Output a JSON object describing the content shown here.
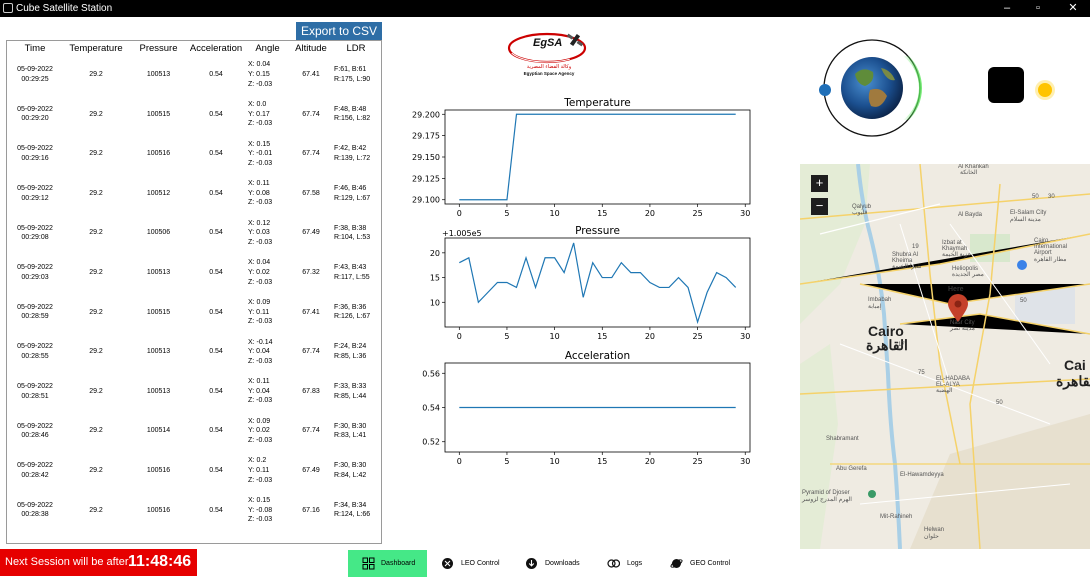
{
  "window": {
    "title": "Cube Satellite Station"
  },
  "toolbar": {
    "export_label": "Export to CSV"
  },
  "table": {
    "headers": [
      "Time",
      "Temperature",
      "Pressure",
      "Acceleration",
      "Angle",
      "Altitude",
      "LDR"
    ],
    "rows": [
      {
        "date": "05-09-2022",
        "clock": "00:29:25",
        "temp": "29.2",
        "pressure": "100513",
        "accel": "0.54",
        "ax": "X: 0.04",
        "ay": "Y: 0.15",
        "az": "Z: -0.03",
        "alt": "67.41",
        "ldr1": "F:61,  B:61",
        "ldr2": "R:175,  L:90"
      },
      {
        "date": "05-09-2022",
        "clock": "00:29:20",
        "temp": "29.2",
        "pressure": "100515",
        "accel": "0.54",
        "ax": "X: 0.0",
        "ay": "Y: 0.17",
        "az": "Z: -0.03",
        "alt": "67.74",
        "ldr1": "F:48,  B:48",
        "ldr2": "R:156,  L:82"
      },
      {
        "date": "05-09-2022",
        "clock": "00:29:16",
        "temp": "29.2",
        "pressure": "100516",
        "accel": "0.54",
        "ax": "X: 0.15",
        "ay": "Y: -0.01",
        "az": "Z: -0.03",
        "alt": "67.74",
        "ldr1": "F:42,  B:42",
        "ldr2": "R:139,  L:72"
      },
      {
        "date": "05-09-2022",
        "clock": "00:29:12",
        "temp": "29.2",
        "pressure": "100512",
        "accel": "0.54",
        "ax": "X: 0.11",
        "ay": "Y: 0.08",
        "az": "Z: -0.03",
        "alt": "67.58",
        "ldr1": "F:46,  B:46",
        "ldr2": "R:129,  L:67"
      },
      {
        "date": "05-09-2022",
        "clock": "00:29:08",
        "temp": "29.2",
        "pressure": "100506",
        "accel": "0.54",
        "ax": "X: 0.12",
        "ay": "Y: 0.03",
        "az": "Z: -0.03",
        "alt": "67.49",
        "ldr1": "F:38,  B:38",
        "ldr2": "R:104,  L:53"
      },
      {
        "date": "05-09-2022",
        "clock": "00:29:03",
        "temp": "29.2",
        "pressure": "100513",
        "accel": "0.54",
        "ax": "X: 0.04",
        "ay": "Y: 0.02",
        "az": "Z: -0.03",
        "alt": "67.32",
        "ldr1": "F:43,  B:43",
        "ldr2": "R:117,  L:55"
      },
      {
        "date": "05-09-2022",
        "clock": "00:28:59",
        "temp": "29.2",
        "pressure": "100515",
        "accel": "0.54",
        "ax": "X: 0.09",
        "ay": "Y: 0.11",
        "az": "Z: -0.03",
        "alt": "67.41",
        "ldr1": "F:36,  B:36",
        "ldr2": "R:126,  L:67"
      },
      {
        "date": "05-09-2022",
        "clock": "00:28:55",
        "temp": "29.2",
        "pressure": "100513",
        "accel": "0.54",
        "ax": "X: -0.14",
        "ay": "Y: 0.04",
        "az": "Z: -0.03",
        "alt": "67.74",
        "ldr1": "F:24,  B:24",
        "ldr2": "R:85,  L:36"
      },
      {
        "date": "05-09-2022",
        "clock": "00:28:51",
        "temp": "29.2",
        "pressure": "100513",
        "accel": "0.54",
        "ax": "X: 0.11",
        "ay": "Y: 0.04",
        "az": "Z: -0.03",
        "alt": "67.83",
        "ldr1": "F:33,  B:33",
        "ldr2": "R:85,  L:44"
      },
      {
        "date": "05-09-2022",
        "clock": "00:28:46",
        "temp": "29.2",
        "pressure": "100514",
        "accel": "0.54",
        "ax": "X: 0.09",
        "ay": "Y: 0.02",
        "az": "Z: -0.03",
        "alt": "67.74",
        "ldr1": "F:30,  B:30",
        "ldr2": "R:83,  L:41"
      },
      {
        "date": "05-09-2022",
        "clock": "00:28:42",
        "temp": "29.2",
        "pressure": "100516",
        "accel": "0.54",
        "ax": "X: 0.2",
        "ay": "Y: 0.11",
        "az": "Z: -0.03",
        "alt": "67.49",
        "ldr1": "F:30,  B:30",
        "ldr2": "R:84,  L:42"
      },
      {
        "date": "05-09-2022",
        "clock": "00:28:38",
        "temp": "29.2",
        "pressure": "100516",
        "accel": "0.54",
        "ax": "X: 0.15",
        "ay": "Y: -0.08",
        "az": "Z: -0.03",
        "alt": "67.16",
        "ldr1": "F:34,  B:34",
        "ldr2": "R:124,  L:66"
      }
    ]
  },
  "logo": {
    "name": "EgSA",
    "arabic": "وكالة الفضاء المصرية",
    "english": "Egyptian Space Agency"
  },
  "chart_data": [
    {
      "type": "line",
      "title": "Temperature",
      "x": [
        0,
        1,
        2,
        3,
        4,
        5,
        6,
        7,
        8,
        9,
        10,
        11,
        12,
        13,
        14,
        15,
        16,
        17,
        18,
        19,
        20,
        21,
        22,
        23,
        24,
        25,
        26,
        27,
        28,
        29
      ],
      "values": [
        29.1,
        29.1,
        29.1,
        29.1,
        29.1,
        29.1,
        29.2,
        29.2,
        29.2,
        29.2,
        29.2,
        29.2,
        29.2,
        29.2,
        29.2,
        29.2,
        29.2,
        29.2,
        29.2,
        29.2,
        29.2,
        29.2,
        29.2,
        29.2,
        29.2,
        29.2,
        29.2,
        29.2,
        29.2,
        29.2
      ],
      "xlim": [
        -1.5,
        30.5
      ],
      "ylim": [
        29.095,
        29.205
      ],
      "xticks": [
        0,
        5,
        10,
        15,
        20,
        25,
        30
      ],
      "yticks": [
        29.1,
        29.125,
        29.15,
        29.175,
        29.2
      ],
      "ytick_labels": [
        "29.100",
        "29.125",
        "29.150",
        "29.175",
        "29.200"
      ],
      "offset_label": "",
      "color": "#1f77b4"
    },
    {
      "type": "line",
      "title": "Pressure",
      "x": [
        0,
        1,
        2,
        3,
        4,
        5,
        6,
        7,
        8,
        9,
        10,
        11,
        12,
        13,
        14,
        15,
        16,
        17,
        18,
        19,
        20,
        21,
        22,
        23,
        24,
        25,
        26,
        27,
        28,
        29
      ],
      "values": [
        18,
        19,
        10,
        12,
        14,
        14,
        13,
        19,
        13,
        19,
        19,
        16,
        22,
        11,
        18,
        15,
        15,
        18,
        16,
        16,
        14,
        13,
        13,
        15,
        13,
        6,
        12,
        16,
        15,
        13
      ],
      "xlim": [
        -1.5,
        30.5
      ],
      "ylim": [
        5,
        23
      ],
      "xticks": [
        0,
        5,
        10,
        15,
        20,
        25,
        30
      ],
      "yticks": [
        10,
        15,
        20
      ],
      "ytick_labels": [
        "10",
        "15",
        "20"
      ],
      "offset_label": "+1.005e5",
      "color": "#1f77b4"
    },
    {
      "type": "line",
      "title": "Acceleration",
      "x": [
        0,
        1,
        2,
        3,
        4,
        5,
        6,
        7,
        8,
        9,
        10,
        11,
        12,
        13,
        14,
        15,
        16,
        17,
        18,
        19,
        20,
        21,
        22,
        23,
        24,
        25,
        26,
        27,
        28,
        29
      ],
      "values": [
        0.54,
        0.54,
        0.54,
        0.54,
        0.54,
        0.54,
        0.54,
        0.54,
        0.54,
        0.54,
        0.54,
        0.54,
        0.54,
        0.54,
        0.54,
        0.54,
        0.54,
        0.54,
        0.54,
        0.54,
        0.54,
        0.54,
        0.54,
        0.54,
        0.54,
        0.54,
        0.54,
        0.54,
        0.54,
        0.54
      ],
      "xlim": [
        -1.5,
        30.5
      ],
      "ylim": [
        0.514,
        0.566
      ],
      "xticks": [
        0,
        5,
        10,
        15,
        20,
        25,
        30
      ],
      "yticks": [
        0.52,
        0.54,
        0.56
      ],
      "ytick_labels": [
        "0.52",
        "0.54",
        "0.56"
      ],
      "offset_label": "",
      "color": "#1f77b4"
    }
  ],
  "map": {
    "labels": [
      {
        "id": "cairo-en",
        "text": "Cairo"
      },
      {
        "id": "cairo-ar",
        "text": "القاهرة"
      },
      {
        "id": "here",
        "text": "Here"
      },
      {
        "id": "nasr-city",
        "text": "Nasr City"
      },
      {
        "id": "nasr-city-ar",
        "text": "مدينة نصر"
      },
      {
        "id": "al-khankah",
        "text": "Al Khankah"
      },
      {
        "id": "al-khankah-ar",
        "text": "الخانكة"
      },
      {
        "id": "qalyub",
        "text": "Qalyub"
      },
      {
        "id": "qalyub-ar",
        "text": "قليوب"
      },
      {
        "id": "al-bayda",
        "text": "Al Bayda"
      },
      {
        "id": "el-salam",
        "text": "El-Salam City"
      },
      {
        "id": "el-salam-ar",
        "text": "مدينة السلام"
      },
      {
        "id": "izbat",
        "text": "Izbat at"
      },
      {
        "id": "khaymah",
        "text": "Khaymah"
      },
      {
        "id": "izbat-ar",
        "text": "عزبة الخيمة"
      },
      {
        "id": "shubra",
        "text": "Shubra Al"
      },
      {
        "id": "kheima",
        "text": "Kheima"
      },
      {
        "id": "shubra-ar",
        "text": "شبرا الخيمة"
      },
      {
        "id": "heliopolis",
        "text": "Heliopolis"
      },
      {
        "id": "heliopolis-ar",
        "text": "مصر الجديدة"
      },
      {
        "id": "airport",
        "text": "Cairo"
      },
      {
        "id": "airport2",
        "text": "International"
      },
      {
        "id": "airport3",
        "text": "Airport"
      },
      {
        "id": "airport-ar",
        "text": "مطار القاهرة"
      },
      {
        "id": "imbabah",
        "text": "Imbabah"
      },
      {
        "id": "imbabah-ar",
        "text": "إمبابة"
      },
      {
        "id": "cairo-right",
        "text": "Cai"
      },
      {
        "id": "cairo-right-ar",
        "text": "القاهرة"
      },
      {
        "id": "hadaba",
        "text": "EL-HADABA"
      },
      {
        "id": "hadaba2",
        "text": "EL-ALYA"
      },
      {
        "id": "hadaba-ar",
        "text": "الهضبة"
      },
      {
        "id": "shabramant",
        "text": "Shabramant"
      },
      {
        "id": "abu-gerefa",
        "text": "Abu Gerefa"
      },
      {
        "id": "el-hawamdeya",
        "text": "El-Hawamdeyya"
      },
      {
        "id": "pyramid",
        "text": "Pyramid of Djoser"
      },
      {
        "id": "pyramid-ar",
        "text": "الهرم المدرج لزوسر"
      },
      {
        "id": "mit-rahineh",
        "text": "Mit-Rahineh"
      },
      {
        "id": "helwan",
        "text": "Helwan"
      },
      {
        "id": "helwan-ar",
        "text": "حلوان"
      },
      {
        "id": "r50a",
        "text": "50"
      },
      {
        "id": "r50b",
        "text": "50"
      },
      {
        "id": "r50c",
        "text": "50"
      },
      {
        "id": "r30",
        "text": "30"
      },
      {
        "id": "r19",
        "text": "19"
      },
      {
        "id": "r75",
        "text": "75"
      },
      {
        "id": "r17",
        "text": "17"
      }
    ]
  },
  "session": {
    "label": "Next Session will be after",
    "countdown": "11:48:46"
  },
  "nav": {
    "dashboard": "Dashboard",
    "leo": "LEO Control",
    "downloads": "Downloads",
    "logs": "Logs",
    "geo": "GEO Control"
  },
  "colors": {
    "accent": "#2e6ea6",
    "nav_active": "#45e887",
    "session_bg": "#e60000",
    "line": "#1f77b4"
  }
}
